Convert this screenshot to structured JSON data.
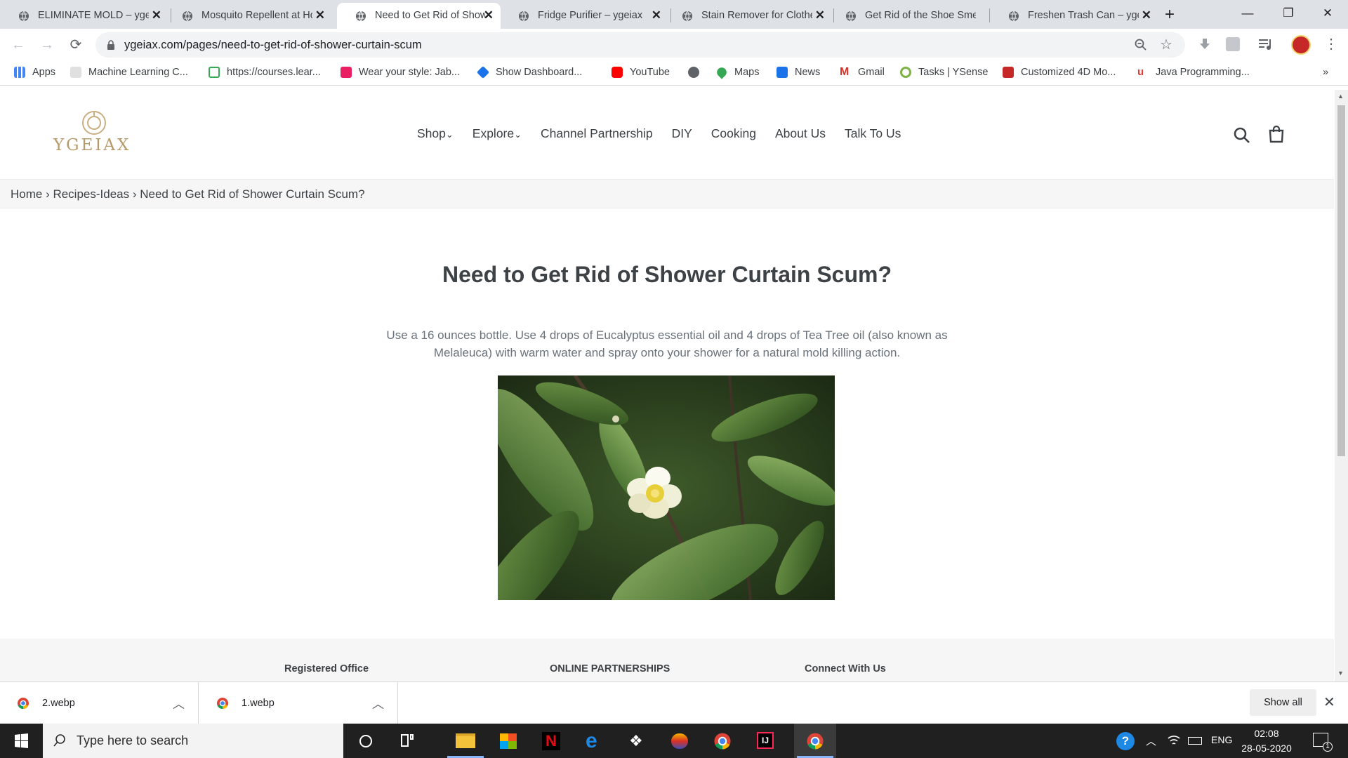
{
  "browser": {
    "tabs": [
      {
        "title": "ELIMINATE MOLD – ygeiax",
        "active": false
      },
      {
        "title": "Mosquito Repellent at Home",
        "active": false
      },
      {
        "title": "Need to Get Rid of Shower Curtain Scum?",
        "active": true
      },
      {
        "title": "Fridge Purifier – ygeiax",
        "active": false
      },
      {
        "title": "Stain Remover for Clothes",
        "active": false
      },
      {
        "title": "Get Rid of the Shoe Smell",
        "active": false
      },
      {
        "title": "Freshen Trash Can – ygeiax",
        "active": false
      }
    ],
    "new_tab": "+",
    "url": "ygeiax.com/pages/need-to-get-rid-of-shower-curtain-scum",
    "bookmarks": [
      {
        "label": "Apps",
        "color": "#4285f4"
      },
      {
        "label": "Machine Learning C...",
        "color": "#3c4043"
      },
      {
        "label": "https://courses.lear...",
        "color": "#34a853"
      },
      {
        "label": "Wear your style: Jab...",
        "color": "#e91e63"
      },
      {
        "label": "Show Dashboard...",
        "color": "#1a73e8"
      },
      {
        "label": "YouTube",
        "color": "#ff0000"
      },
      {
        "label": "",
        "color": "#5f6368"
      },
      {
        "label": "Maps",
        "color": "#34a853"
      },
      {
        "label": "News",
        "color": "#1a73e8"
      },
      {
        "label": "Gmail",
        "color": "#d93025"
      },
      {
        "label": "Tasks | YSense",
        "color": "#7cb342"
      },
      {
        "label": "Customized 4D Mo...",
        "color": "#c62828"
      },
      {
        "label": "Java Programming...",
        "color": "#e53935"
      }
    ],
    "more_bookmarks": "»"
  },
  "site": {
    "logo_text": "YGEIAX",
    "logo_color": "#b79a6a",
    "nav": [
      "Shop",
      "Explore",
      "Channel Partnership",
      "DIY",
      "Cooking",
      "About Us",
      "Talk To Us"
    ],
    "dropdown_glyph": "⌄",
    "breadcrumb": "Home › Recipes-Ideas › Need to Get Rid of Shower Curtain Scum?",
    "title": "Need to Get Rid of Shower Curtain Scum?",
    "body_line1": "Use a 16 ounces bottle. Use 4 drops of Eucalyptus essential oil and 4 drops of Tea Tree oil (also known as",
    "body_line2": "Melaleuca) with warm water and spray onto your shower for a natural mold killing action.",
    "footer_headings": [
      "Registered Office",
      "ONLINE PARTNERSHIPS",
      "Connect With Us"
    ]
  },
  "downloads": {
    "items": [
      "2.webp",
      "1.webp"
    ],
    "show_all": "Show all",
    "close": "✕"
  },
  "taskbar": {
    "search_placeholder": "Type here to search",
    "language": "ENG",
    "time": "02:08",
    "date": "28-05-2020",
    "notification_count": "1"
  }
}
